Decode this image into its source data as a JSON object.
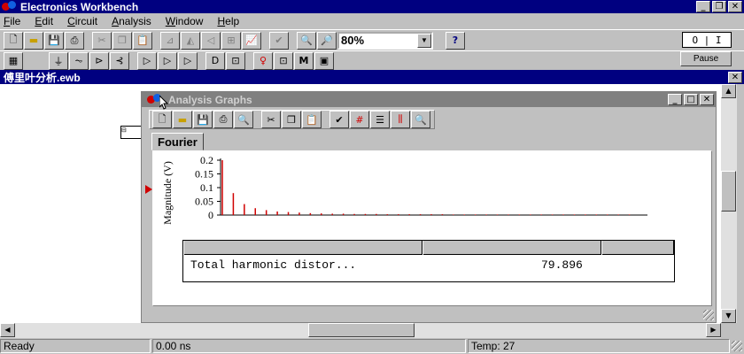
{
  "app": {
    "title": "Electronics Workbench"
  },
  "menu": [
    "File",
    "Edit",
    "Circuit",
    "Analysis",
    "Window",
    "Help"
  ],
  "toolbar": {
    "zoom_value": "80%",
    "help_label": "?",
    "power_label": "O | I",
    "pause_label": "Pause"
  },
  "toolbar2": {
    "m_label": "M"
  },
  "document": {
    "title": "傅里叶分析.ewb"
  },
  "analysis_window": {
    "title": "Analysis Graphs",
    "tab": "Fourier",
    "ylabel": "Magnitude (V)",
    "table": {
      "row_label": "Total harmonic distor...",
      "row_value": "79.896"
    }
  },
  "chart_data": {
    "type": "bar",
    "ylabel": "Magnitude (V)",
    "ytick_labels": [
      "0.2",
      "0.15",
      "0.1",
      "0.05",
      "0"
    ],
    "ylim": [
      0,
      0.2
    ],
    "harmonics": [
      1,
      2,
      3,
      4,
      5,
      6,
      7,
      8,
      9,
      10,
      11,
      12,
      13,
      14,
      15,
      16,
      17,
      18,
      19,
      20,
      21,
      22,
      23,
      24,
      25,
      26,
      27,
      28,
      29,
      30,
      31,
      32,
      33,
      34,
      35,
      36,
      37,
      38
    ],
    "values": [
      0.2,
      0.08,
      0.04,
      0.025,
      0.018,
      0.013,
      0.011,
      0.009,
      0.007,
      0.006,
      0.005,
      0.005,
      0.004,
      0.004,
      0.004,
      0.003,
      0.003,
      0.003,
      0.003,
      0.003,
      0.003,
      0.002,
      0.002,
      0.002,
      0.002,
      0.002,
      0.002,
      0.002,
      0.002,
      0.002,
      0.002,
      0.002,
      0.002,
      0.002,
      0.002,
      0.002,
      0.002,
      0.002
    ],
    "bar_color": "#d00000"
  },
  "status": {
    "ready": "Ready",
    "time": "0.00 ns",
    "temp": "Temp:  27"
  }
}
